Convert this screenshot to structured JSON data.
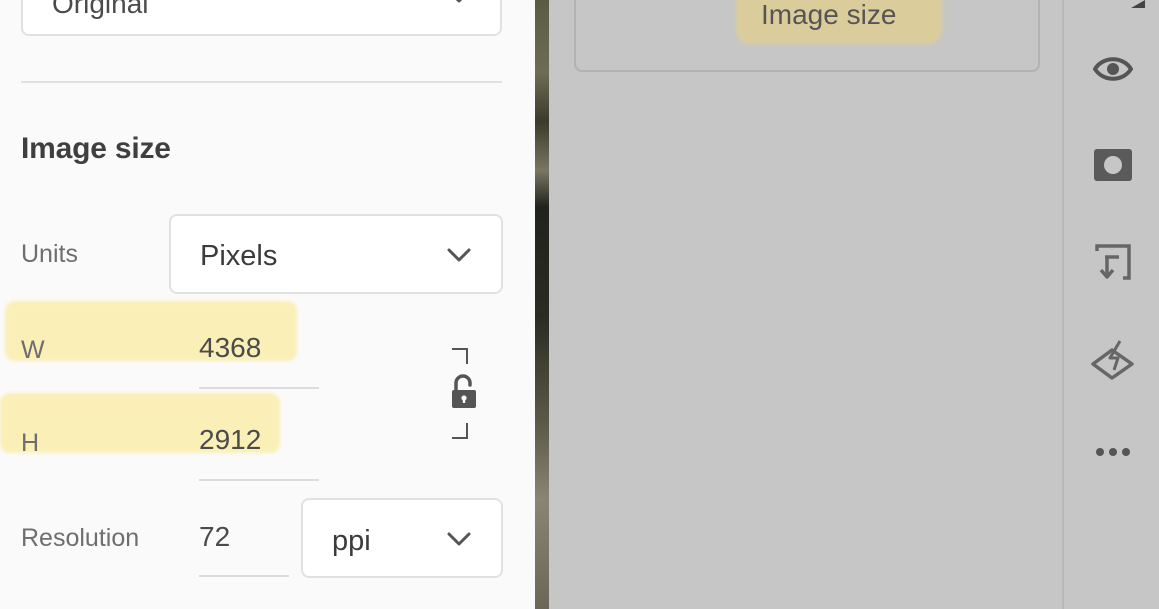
{
  "top_dropdown": {
    "value": "Original"
  },
  "image_size_panel": {
    "title": "Image size",
    "units": {
      "label": "Units",
      "value": "Pixels"
    },
    "width": {
      "label": "W",
      "value": "4368"
    },
    "height": {
      "label": "H",
      "value": "2912"
    },
    "resolution": {
      "label": "Resolution",
      "value": "72",
      "unit": "ppi"
    }
  },
  "canvas": {
    "button_label": "Image size"
  },
  "toolbar": {
    "icons": [
      "arrow-icon",
      "eye-icon",
      "mask-icon",
      "export-icon",
      "eraser-icon",
      "more-icon"
    ]
  },
  "colors": {
    "panel_bg": "#fafafa",
    "canvas_bg": "#c6c6c6",
    "highlight": "#fae88c"
  }
}
